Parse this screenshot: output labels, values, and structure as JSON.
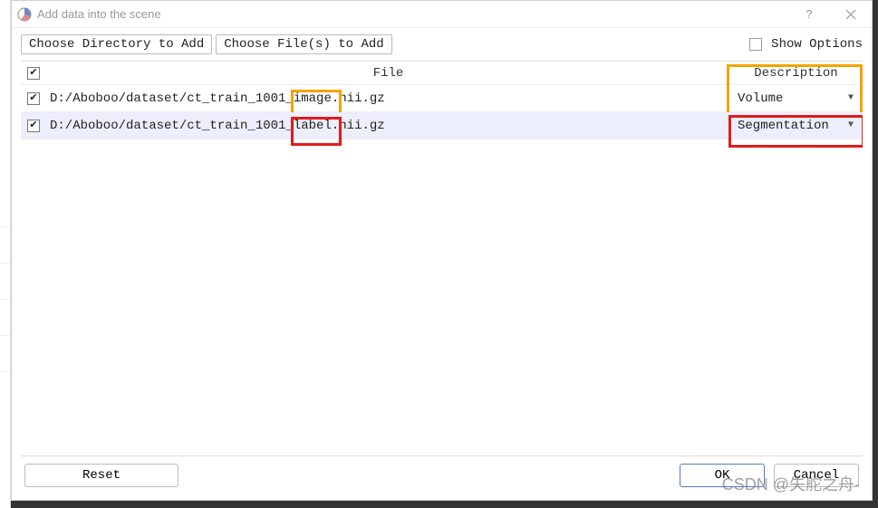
{
  "window": {
    "title": "Add data into the scene"
  },
  "toolbar": {
    "choose_dir": "Choose Directory to Add",
    "choose_files": "Choose File(s) to Add",
    "show_options": "Show Options"
  },
  "table": {
    "headers": {
      "file": "File",
      "desc": "Description"
    },
    "rows": [
      {
        "checked": true,
        "path_pre": "D:/Aboboo/dataset/ct_train_1001_",
        "path_mid": "image.",
        "path_post": "nii.gz",
        "description": "Volume",
        "selected": false
      },
      {
        "checked": true,
        "path_pre": "D:/Aboboo/dataset/ct_train_1001_",
        "path_mid": "label.",
        "path_post": "nii.gz",
        "description": "Segmentation",
        "selected": true
      }
    ]
  },
  "footer": {
    "reset": "Reset",
    "ok": "OK",
    "cancel": "Cancel"
  },
  "watermark": "CSDN @失舵之舟-"
}
